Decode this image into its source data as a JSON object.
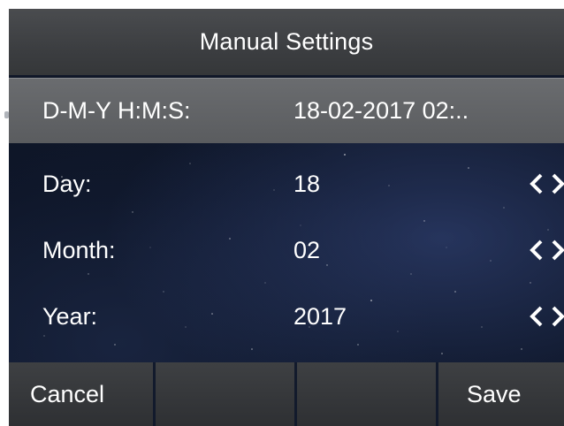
{
  "title": "Manual Settings",
  "rows": [
    {
      "label": "D-M-Y H:M:S:",
      "value": "18-02-2017 02:.."
    },
    {
      "label": "Day:",
      "value": "18"
    },
    {
      "label": "Month:",
      "value": "02"
    },
    {
      "label": "Year:",
      "value": "2017"
    }
  ],
  "softkeys": [
    "Cancel",
    "",
    "",
    "Save"
  ],
  "colors": {
    "title_bar": "#3c3e41",
    "selected_row": "#5f6164",
    "background": "#0b1222",
    "text": "#ffffff"
  }
}
